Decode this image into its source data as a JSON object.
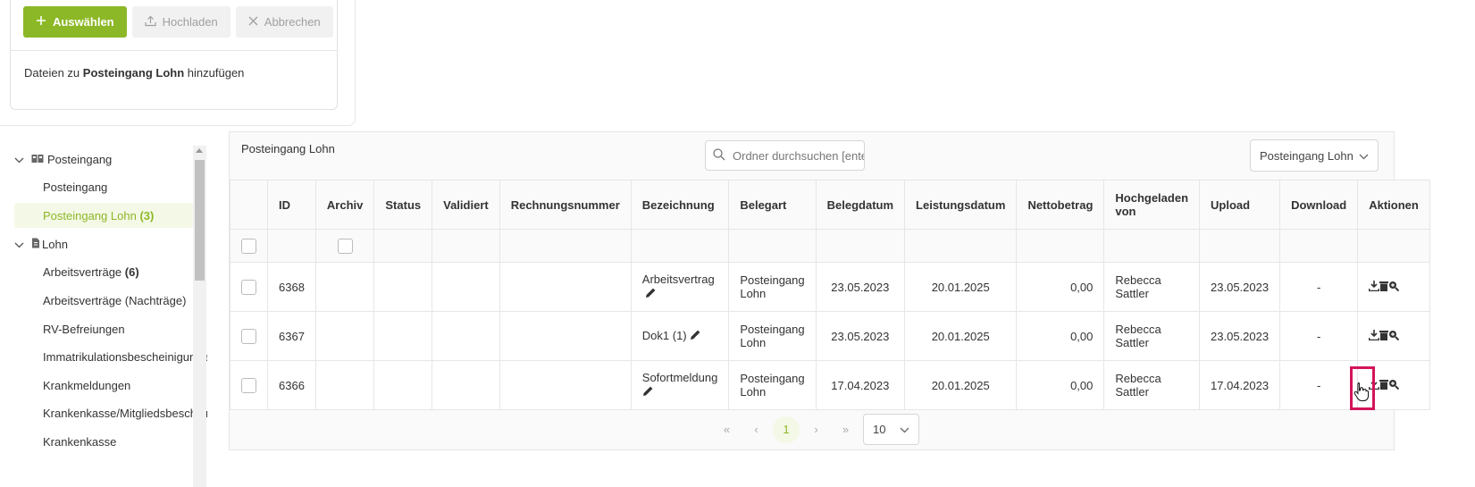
{
  "upload": {
    "select_label": "Auswählen",
    "upload_label": "Hochladen",
    "cancel_label": "Abbrechen",
    "info_prefix": "Dateien zu",
    "info_folder": "Posteingang Lohn",
    "info_suffix": "hinzufügen"
  },
  "tree": {
    "groups": [
      {
        "label": "Posteingang"
      },
      {
        "label": "Lohn"
      }
    ],
    "posteingang": "Posteingang",
    "posteingang_lohn": "Posteingang Lohn",
    "posteingang_lohn_count": "(3)",
    "arbeitsvertraege": "Arbeitsverträge",
    "arbeitsvertraege_count": "(6)",
    "arbeitsvertraege_nachtraege": "Arbeitsverträge (Nachträge)",
    "rv_befreiungen": "RV-Befreiungen",
    "immatrikulation": "Immatrikulationsbescheinigungen",
    "krankmeldungen": "Krankmeldungen",
    "krankenkasse_mitglied": "Krankenkasse/Mitgliedsbescheinigungen",
    "krankenkasse": "Krankenkasse"
  },
  "main": {
    "title": "Posteingang Lohn",
    "search_placeholder": "Ordner durchsuchen [enter]",
    "folder_select": "Posteingang Lohn"
  },
  "table": {
    "headers": {
      "id": "ID",
      "archiv": "Archiv",
      "status": "Status",
      "validiert": "Validiert",
      "rechnungsnummer": "Rechnungsnummer",
      "bezeichnung": "Bezeichnung",
      "belegart": "Belegart",
      "belegdatum": "Belegdatum",
      "leistungsdatum": "Leistungsdatum",
      "nettobetrag": "Nettobetrag",
      "hochgeladen_von": "Hochgeladen von",
      "upload": "Upload",
      "download": "Download",
      "aktionen": "Aktionen"
    },
    "rows": [
      {
        "id": "6368",
        "bezeichnung": "Arbeitsvertrag",
        "belegart": "Posteingang Lohn",
        "belegdatum": "23.05.2023",
        "leistungsdatum": "20.01.2025",
        "nettobetrag": "0,00",
        "hochgeladen_von": "Rebecca Sattler",
        "upload": "23.05.2023",
        "download": "-"
      },
      {
        "id": "6367",
        "bezeichnung": "Dok1 (1)",
        "belegart": "Posteingang Lohn",
        "belegdatum": "23.05.2023",
        "leistungsdatum": "20.01.2025",
        "nettobetrag": "0,00",
        "hochgeladen_von": "Rebecca Sattler",
        "upload": "23.05.2023",
        "download": "-"
      },
      {
        "id": "6366",
        "bezeichnung": "Sofortmeldung",
        "belegart": "Posteingang Lohn",
        "belegdatum": "17.04.2023",
        "leistungsdatum": "20.01.2025",
        "nettobetrag": "0,00",
        "hochgeladen_von": "Rebecca Sattler",
        "upload": "17.04.2023",
        "download": "-"
      }
    ]
  },
  "pager": {
    "first": "«",
    "prev": "‹",
    "current": "1",
    "next": "›",
    "last": "»",
    "page_size": "10"
  },
  "colors": {
    "accent": "#8cb827",
    "highlight": "#d4145a"
  }
}
